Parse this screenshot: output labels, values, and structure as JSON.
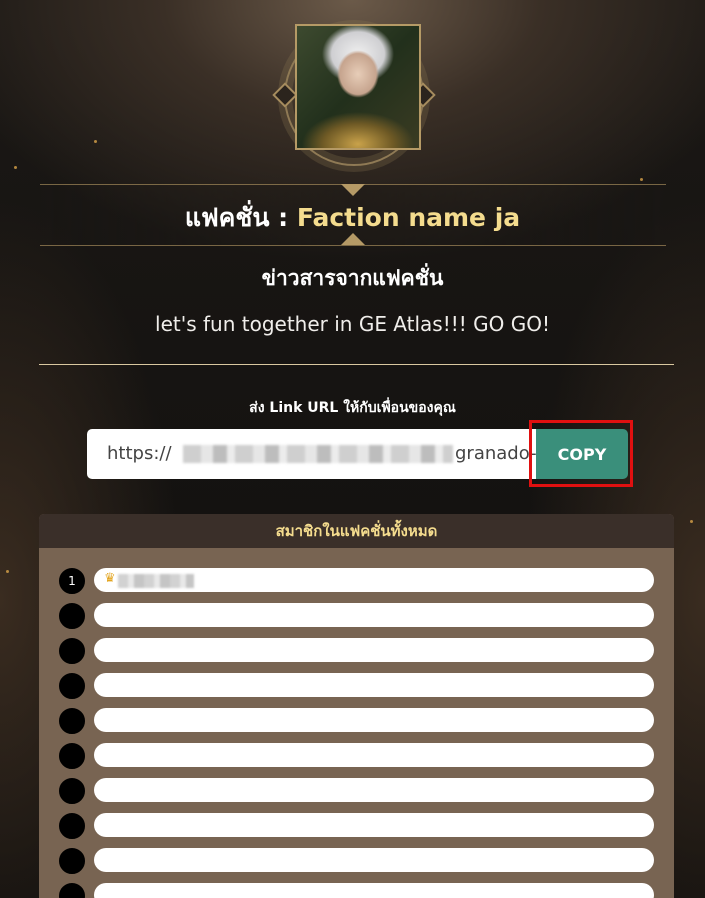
{
  "faction": {
    "label": "แฟคชั่น :",
    "name": "Faction name ja"
  },
  "news": {
    "heading": "ข่าวสารจากแฟคชั่น",
    "text": "let's fun together in GE Atlas!!! GO GO!"
  },
  "share": {
    "label": "ส่ง Link URL ให้กับเพื่อนของคุณ",
    "url_prefix": "https://",
    "url_suffix": "granado-",
    "copy_label": "COPY"
  },
  "members": {
    "header": "สมาชิกในแฟคชั่นทั้งหมด",
    "rows": [
      {
        "rank": "1",
        "leader": true
      },
      {
        "rank": ""
      },
      {
        "rank": ""
      },
      {
        "rank": ""
      },
      {
        "rank": ""
      },
      {
        "rank": ""
      },
      {
        "rank": ""
      },
      {
        "rank": ""
      },
      {
        "rank": ""
      },
      {
        "rank": ""
      }
    ]
  },
  "colors": {
    "accent_gold": "#f4dc8e",
    "copy_button": "#3a8f7b",
    "highlight": "#e01010",
    "panel": "#786452"
  },
  "icons": {
    "leader": "crown-icon"
  }
}
